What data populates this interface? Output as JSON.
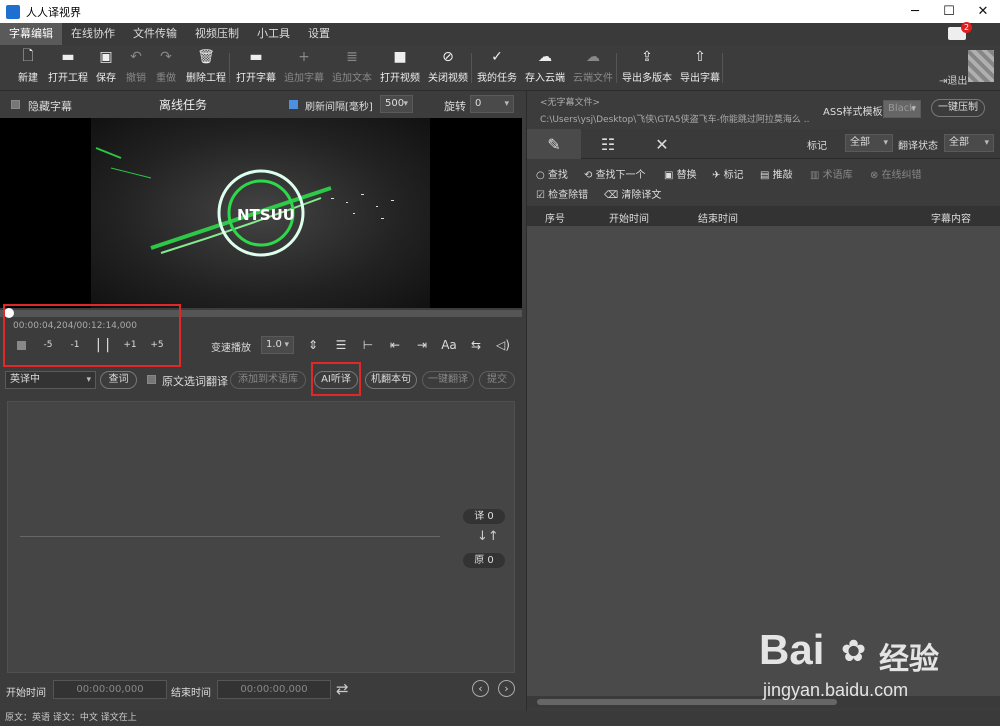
{
  "window": {
    "title": "人人译视界",
    "minimize": "─",
    "maximize": "☐",
    "close": "✕"
  },
  "menu": [
    {
      "label": "字幕编辑",
      "active": true
    },
    {
      "label": "在线协作"
    },
    {
      "label": "文件传输"
    },
    {
      "label": "视频压制"
    },
    {
      "label": "小工具"
    },
    {
      "label": "设置"
    }
  ],
  "notifications": {
    "count": "2"
  },
  "toolbar": [
    {
      "label": "新建",
      "icon": "new-file-icon",
      "glyph": "🗋"
    },
    {
      "label": "打开工程",
      "icon": "folder-icon",
      "glyph": "▬"
    },
    {
      "label": "保存",
      "icon": "save-icon",
      "glyph": "▣"
    },
    {
      "label": "撤销",
      "icon": "undo-icon",
      "glyph": "↶",
      "disabled": true
    },
    {
      "label": "重做",
      "icon": "redo-icon",
      "glyph": "↷",
      "disabled": true
    },
    {
      "label": "删除工程",
      "icon": "trash-icon",
      "glyph": "🗑"
    },
    {
      "label": "打开字幕",
      "icon": "folder-open-icon",
      "glyph": "▬"
    },
    {
      "label": "追加字幕",
      "icon": "plus-icon",
      "glyph": "+",
      "disabled": true
    },
    {
      "label": "追加文本",
      "icon": "text-doc-icon",
      "glyph": "≣",
      "disabled": true
    },
    {
      "label": "打开视频",
      "icon": "video-camera-icon",
      "glyph": "■"
    },
    {
      "label": "关闭视频",
      "icon": "video-off-icon",
      "glyph": "⊘"
    },
    {
      "label": "我的任务",
      "icon": "clipboard-icon",
      "glyph": "✓"
    },
    {
      "label": "存入云端",
      "icon": "cloud-icon",
      "glyph": "☁"
    },
    {
      "label": "云端文件",
      "icon": "cloud-upload-icon",
      "glyph": "☁",
      "disabled": true
    },
    {
      "label": "导出多版本",
      "icon": "layers-export-icon",
      "glyph": "⇪"
    },
    {
      "label": "导出字幕",
      "icon": "export-file-icon",
      "glyph": "⇧"
    }
  ],
  "user": {
    "logout": "退出"
  },
  "left": {
    "hide_subtitles": "隐藏字幕",
    "task_title": "离线任务",
    "refresh_label": "刷新间隔[毫秒]",
    "refresh_value": "500",
    "rotate_label": "旋转",
    "rotate_value": "0",
    "video_logo_text": "NTSUU",
    "time": "00:00:04,204/00:12:14,000",
    "speed_label": "变速播放",
    "speed_value": "1.0",
    "controls": {
      "back5": "-5",
      "back1": "-1",
      "play_pause": "| |",
      "fwd1": "+1",
      "fwd5": "+5"
    },
    "lang_select": "英译中",
    "lookup": "查词",
    "source_select_translate": "原文选词翻译",
    "add_glossary": "添加到术语库",
    "ai_listen": "AI听译",
    "mt_sentence": "机翻本句",
    "one_click_translate": "一键翻译",
    "submit": "提交",
    "count_trans": "译 0",
    "count_orig": "原 0",
    "swap_icon": "↓↑",
    "start_time_label": "开始时间",
    "start_time_value": "00:00:00,000",
    "end_time_label": "结束时间",
    "end_time_value": "00:00:00,000"
  },
  "status": {
    "text": "原文：英语  译文：中文    译文在上"
  },
  "right": {
    "no_subtitle_file": "<无字幕文件>",
    "file_path": "C:\\Users\\ysj\\Desktop\\飞侠\\GTA5侠盗飞车-你能跳过阿拉莫海么 ...",
    "ass_label": "ASS样式模板",
    "ass_value": "Black",
    "one_click_burn": "一键压制",
    "mark_label": "标记",
    "mark_value": "全部",
    "trans_status_label": "翻译状态",
    "trans_status_value": "全部",
    "tools": {
      "find": "查找",
      "find_next": "查找下一个",
      "replace": "替换",
      "mark": "标记",
      "push": "推敲",
      "glossary": "术语库",
      "online_correct": "在线纠错",
      "check_errors": "检查除错",
      "clear_translation": "清除译文"
    },
    "columns": [
      "序号",
      "开始时间",
      "结束时间",
      "字幕内容"
    ]
  },
  "watermark": {
    "brand": "Bai",
    "brand2": "经验",
    "url": "jingyan.baidu.com"
  },
  "colors": {
    "accent_red": "#e02828",
    "check_blue": "#4f8fe0",
    "logo_green": "#2fd84a"
  }
}
